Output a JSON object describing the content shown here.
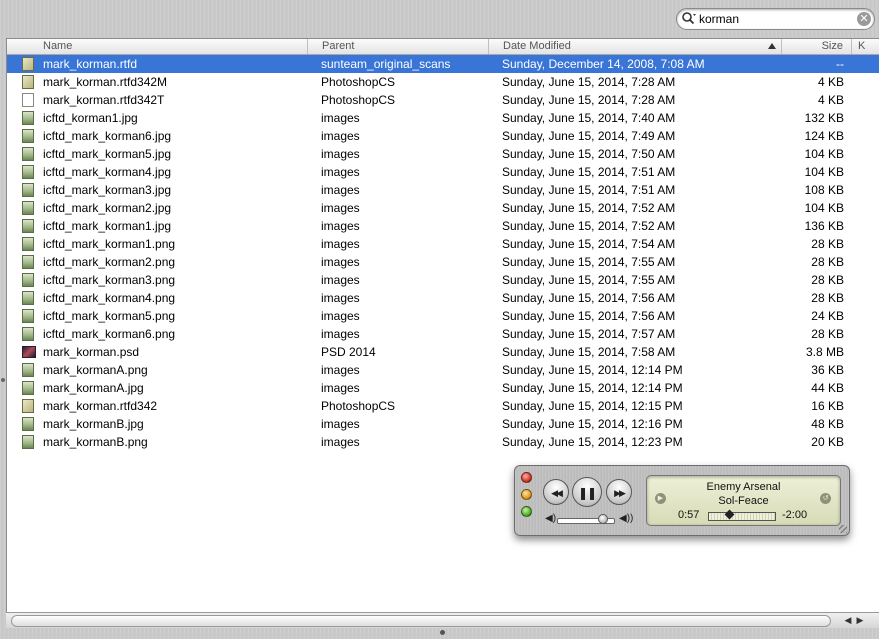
{
  "search": {
    "query": "korman",
    "icon": "magnifier-icon",
    "clear_glyph": "✕"
  },
  "columns": {
    "name": "Name",
    "parent": "Parent",
    "date": "Date Modified",
    "size": "Size",
    "extra": "K"
  },
  "files": [
    {
      "name": "mark_korman.rtfd",
      "parent": "sunteam_original_scans",
      "date": "Sunday, December 14, 2008, 7:08 AM",
      "size": "--",
      "icon": "rtf",
      "selected": true
    },
    {
      "name": "mark_korman.rtfd342M",
      "parent": "PhotoshopCS",
      "date": "Sunday, June 15, 2014, 7:28 AM",
      "size": "4 KB",
      "icon": "rtf"
    },
    {
      "name": "mark_korman.rtfd342T",
      "parent": "PhotoshopCS",
      "date": "Sunday, June 15, 2014, 7:28 AM",
      "size": "4 KB",
      "icon": "doc"
    },
    {
      "name": "icftd_korman1.jpg",
      "parent": "images",
      "date": "Sunday, June 15, 2014, 7:40 AM",
      "size": "132 KB",
      "icon": "img"
    },
    {
      "name": "icftd_mark_korman6.jpg",
      "parent": "images",
      "date": "Sunday, June 15, 2014, 7:49 AM",
      "size": "124 KB",
      "icon": "img"
    },
    {
      "name": "icftd_mark_korman5.jpg",
      "parent": "images",
      "date": "Sunday, June 15, 2014, 7:50 AM",
      "size": "104 KB",
      "icon": "img"
    },
    {
      "name": "icftd_mark_korman4.jpg",
      "parent": "images",
      "date": "Sunday, June 15, 2014, 7:51 AM",
      "size": "104 KB",
      "icon": "img"
    },
    {
      "name": "icftd_mark_korman3.jpg",
      "parent": "images",
      "date": "Sunday, June 15, 2014, 7:51 AM",
      "size": "108 KB",
      "icon": "img"
    },
    {
      "name": "icftd_mark_korman2.jpg",
      "parent": "images",
      "date": "Sunday, June 15, 2014, 7:52 AM",
      "size": "104 KB",
      "icon": "img"
    },
    {
      "name": "icftd_mark_korman1.jpg",
      "parent": "images",
      "date": "Sunday, June 15, 2014, 7:52 AM",
      "size": "136 KB",
      "icon": "img"
    },
    {
      "name": "icftd_mark_korman1.png",
      "parent": "images",
      "date": "Sunday, June 15, 2014, 7:54 AM",
      "size": "28 KB",
      "icon": "img"
    },
    {
      "name": "icftd_mark_korman2.png",
      "parent": "images",
      "date": "Sunday, June 15, 2014, 7:55 AM",
      "size": "28 KB",
      "icon": "img"
    },
    {
      "name": "icftd_mark_korman3.png",
      "parent": "images",
      "date": "Sunday, June 15, 2014, 7:55 AM",
      "size": "28 KB",
      "icon": "img"
    },
    {
      "name": "icftd_mark_korman4.png",
      "parent": "images",
      "date": "Sunday, June 15, 2014, 7:56 AM",
      "size": "28 KB",
      "icon": "img"
    },
    {
      "name": "icftd_mark_korman5.png",
      "parent": "images",
      "date": "Sunday, June 15, 2014, 7:56 AM",
      "size": "24 KB",
      "icon": "img"
    },
    {
      "name": "icftd_mark_korman6.png",
      "parent": "images",
      "date": "Sunday, June 15, 2014, 7:57 AM",
      "size": "28 KB",
      "icon": "img"
    },
    {
      "name": "mark_korman.psd",
      "parent": "PSD 2014",
      "date": "Sunday, June 15, 2014, 7:58 AM",
      "size": "3.8 MB",
      "icon": "psd"
    },
    {
      "name": "mark_kormanA.png",
      "parent": "images",
      "date": "Sunday, June 15, 2014, 12:14 PM",
      "size": "36 KB",
      "icon": "img"
    },
    {
      "name": "mark_kormanA.jpg",
      "parent": "images",
      "date": "Sunday, June 15, 2014, 12:14 PM",
      "size": "44 KB",
      "icon": "img"
    },
    {
      "name": "mark_korman.rtfd342",
      "parent": "PhotoshopCS",
      "date": "Sunday, June 15, 2014, 12:15 PM",
      "size": "16 KB",
      "icon": "rtf"
    },
    {
      "name": "mark_kormanB.jpg",
      "parent": "images",
      "date": "Sunday, June 15, 2014, 12:16 PM",
      "size": "48 KB",
      "icon": "img"
    },
    {
      "name": "mark_kormanB.png",
      "parent": "images",
      "date": "Sunday, June 15, 2014, 12:23 PM",
      "size": "20 KB",
      "icon": "img"
    }
  ],
  "player": {
    "artist": "Enemy Arsenal",
    "song": "Sol-Feace",
    "elapsed": "0:57",
    "remaining": "-2:00",
    "progress_fraction": 0.32,
    "volume_fraction": 0.82,
    "rewind_glyph": "◀◀",
    "pause_glyph": "❚❚",
    "forward_glyph": "▶▶"
  },
  "colors": {
    "selection": "#3875d7",
    "lcd": "#e5e8c8"
  }
}
